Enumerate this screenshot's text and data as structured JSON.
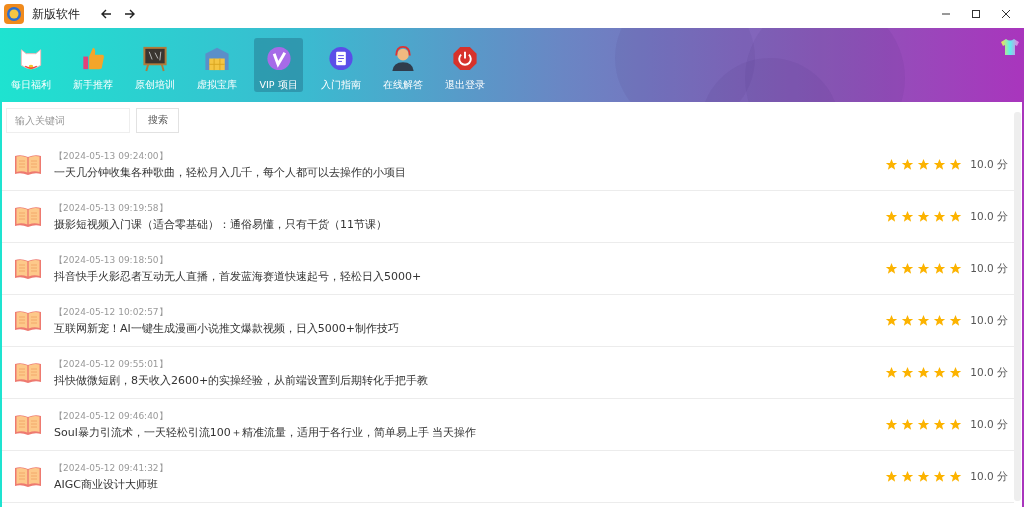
{
  "window": {
    "title": "新版软件"
  },
  "nav_items": [
    {
      "label": "每日福利",
      "selected": false,
      "kind": "cat"
    },
    {
      "label": "新手推荐",
      "selected": false,
      "kind": "thumb"
    },
    {
      "label": "原创培训",
      "selected": false,
      "kind": "board"
    },
    {
      "label": "虚拟宝库",
      "selected": false,
      "kind": "store"
    },
    {
      "label": "VIP 项目",
      "selected": true,
      "kind": "vip"
    },
    {
      "label": "入门指南",
      "selected": false,
      "kind": "doc"
    },
    {
      "label": "在线解答",
      "selected": false,
      "kind": "agent"
    },
    {
      "label": "退出登录",
      "selected": false,
      "kind": "power"
    }
  ],
  "search": {
    "placeholder": "输入关键词",
    "button": "搜索"
  },
  "items": [
    {
      "time": "【2024-05-13 09:24:00】",
      "title": "一天几分钟收集各种歌曲，轻松月入几千，每个人都可以去操作的小项目",
      "stars": 5,
      "score": "10.0 分"
    },
    {
      "time": "【2024-05-13 09:19:58】",
      "title": "摄影短视频入门课（适合零基础）：通俗易懂，只有干货（11节课）",
      "stars": 5,
      "score": "10.0 分"
    },
    {
      "time": "【2024-05-13 09:18:50】",
      "title": "抖音快手火影忍者互动无人直播，首发蓝海赛道快速起号，轻松日入5000+",
      "stars": 5,
      "score": "10.0 分"
    },
    {
      "time": "【2024-05-12 10:02:57】",
      "title": "互联网新宠！AI一键生成漫画小说推文爆款视频，日入5000+制作技巧",
      "stars": 5,
      "score": "10.0 分"
    },
    {
      "time": "【2024-05-12 09:55:01】",
      "title": "抖快做微短剧，8天收入2600+的实操经验，从前端设置到后期转化手把手教",
      "stars": 5,
      "score": "10.0 分"
    },
    {
      "time": "【2024-05-12 09:46:40】",
      "title": "Soul暴力引流术，一天轻松引流100＋精准流量，适用于各行业，简单易上手 当天操作",
      "stars": 5,
      "score": "10.0 分"
    },
    {
      "time": "【2024-05-12 09:41:32】",
      "title": "AIGC商业设计大师班",
      "stars": 5,
      "score": "10.0 分"
    }
  ]
}
